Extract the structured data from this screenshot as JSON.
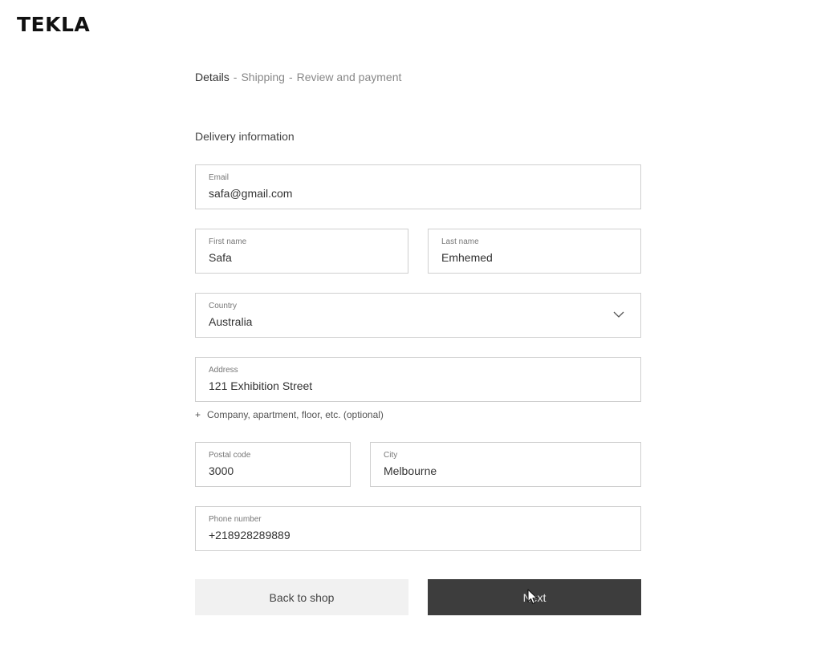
{
  "brand": {
    "logo": "TEKLA"
  },
  "steps": {
    "items": [
      "Details",
      "Shipping",
      "Review and payment"
    ],
    "separator": "-",
    "active_index": 0
  },
  "section": {
    "title": "Delivery information"
  },
  "form": {
    "email": {
      "label": "Email",
      "value": "safa@gmail.com"
    },
    "first_name": {
      "label": "First name",
      "value": "Safa"
    },
    "last_name": {
      "label": "Last name",
      "value": "Emhemed"
    },
    "country": {
      "label": "Country",
      "value": "Australia",
      "icon": "chevron-down-icon"
    },
    "address": {
      "label": "Address",
      "value": "121 Exhibition Street"
    },
    "add_more": {
      "symbol": "+",
      "label": "Company, apartment, floor, etc. (optional)"
    },
    "postal_code": {
      "label": "Postal code",
      "value": "3000"
    },
    "city": {
      "label": "City",
      "value": "Melbourne"
    },
    "phone": {
      "label": "Phone number",
      "value": "+218928289889"
    }
  },
  "actions": {
    "back_label": "Back to shop",
    "next_label": "Next"
  },
  "colors": {
    "primary_button": "#3d3d3d",
    "secondary_button": "#f1f1f1",
    "border": "#cfcfcf"
  }
}
